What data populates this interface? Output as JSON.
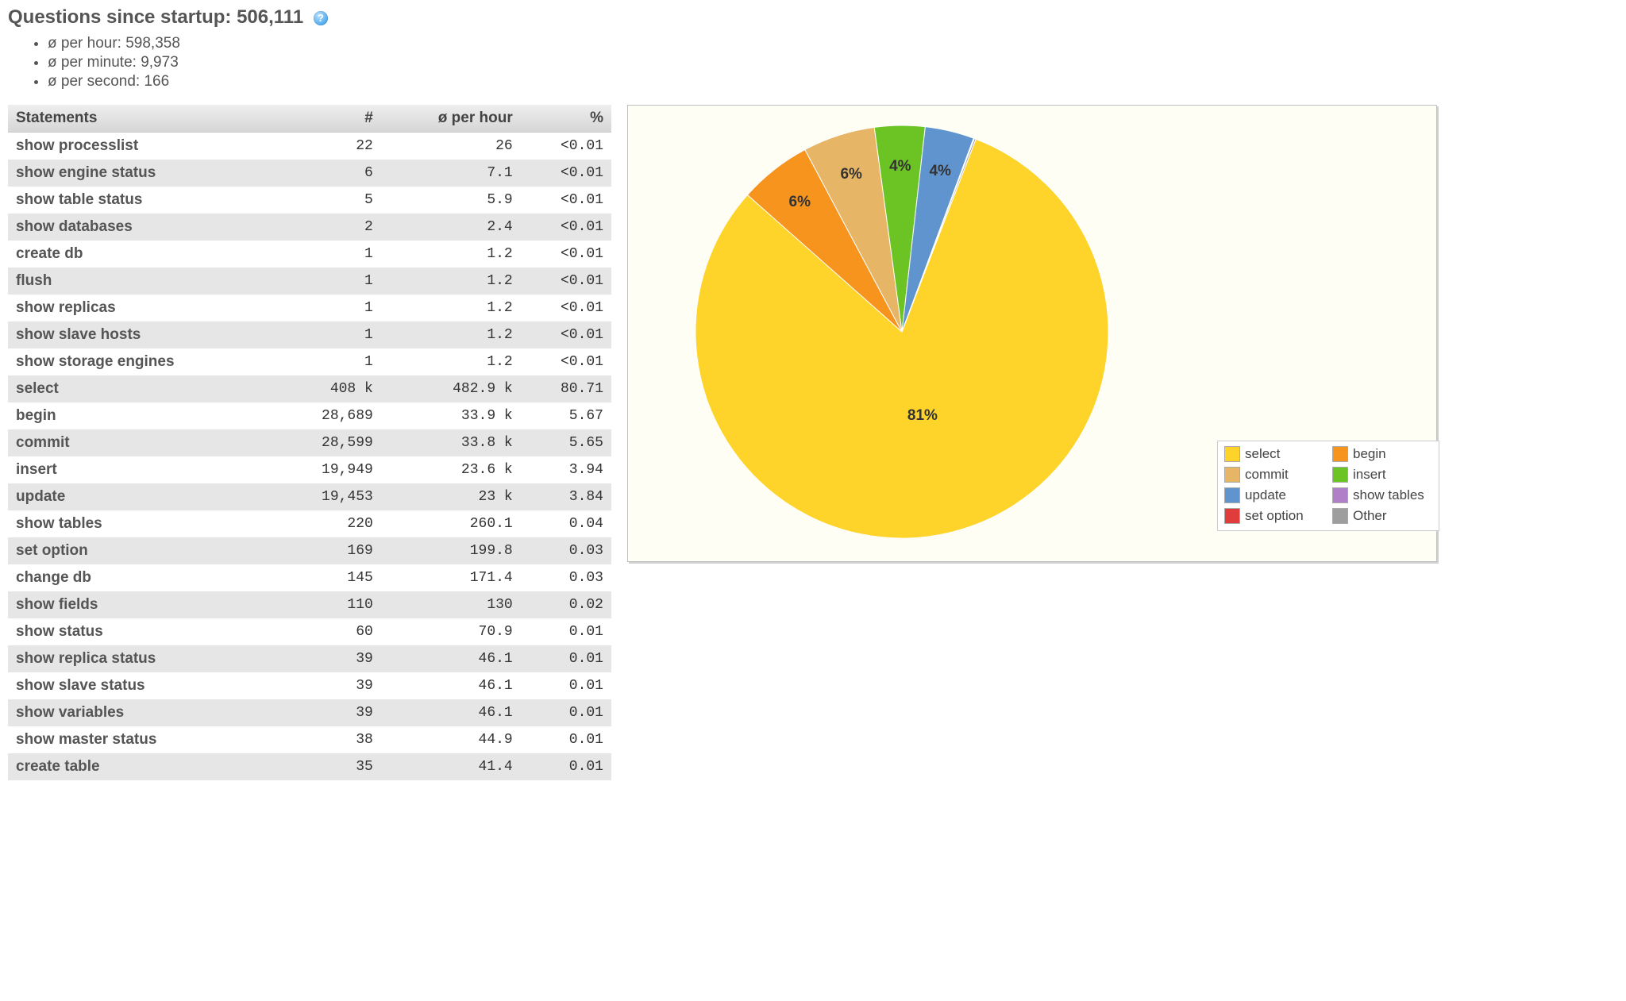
{
  "header": {
    "title_prefix": "Questions since startup: ",
    "title_value": "506,111",
    "help_tooltip": "?"
  },
  "summary": {
    "per_hour": "ø per hour: 598,358",
    "per_minute": "ø per minute: 9,973",
    "per_second": "ø per second: 166"
  },
  "table": {
    "headers": {
      "statements": "Statements",
      "count": "#",
      "per_hour": "ø per hour",
      "percent": "%"
    },
    "rows": [
      {
        "name": "show processlist",
        "count": "22",
        "per_hour": "26",
        "percent": "<0.01"
      },
      {
        "name": "show engine status",
        "count": "6",
        "per_hour": "7.1",
        "percent": "<0.01"
      },
      {
        "name": "show table status",
        "count": "5",
        "per_hour": "5.9",
        "percent": "<0.01"
      },
      {
        "name": "show databases",
        "count": "2",
        "per_hour": "2.4",
        "percent": "<0.01"
      },
      {
        "name": "create db",
        "count": "1",
        "per_hour": "1.2",
        "percent": "<0.01"
      },
      {
        "name": "flush",
        "count": "1",
        "per_hour": "1.2",
        "percent": "<0.01"
      },
      {
        "name": "show replicas",
        "count": "1",
        "per_hour": "1.2",
        "percent": "<0.01"
      },
      {
        "name": "show slave hosts",
        "count": "1",
        "per_hour": "1.2",
        "percent": "<0.01"
      },
      {
        "name": "show storage engines",
        "count": "1",
        "per_hour": "1.2",
        "percent": "<0.01"
      },
      {
        "name": "select",
        "count": "408 k",
        "per_hour": "482.9 k",
        "percent": "80.71"
      },
      {
        "name": "begin",
        "count": "28,689",
        "per_hour": "33.9 k",
        "percent": "5.67"
      },
      {
        "name": "commit",
        "count": "28,599",
        "per_hour": "33.8 k",
        "percent": "5.65"
      },
      {
        "name": "insert",
        "count": "19,949",
        "per_hour": "23.6 k",
        "percent": "3.94"
      },
      {
        "name": "update",
        "count": "19,453",
        "per_hour": "23 k",
        "percent": "3.84"
      },
      {
        "name": "show tables",
        "count": "220",
        "per_hour": "260.1",
        "percent": "0.04"
      },
      {
        "name": "set option",
        "count": "169",
        "per_hour": "199.8",
        "percent": "0.03"
      },
      {
        "name": "change db",
        "count": "145",
        "per_hour": "171.4",
        "percent": "0.03"
      },
      {
        "name": "show fields",
        "count": "110",
        "per_hour": "130",
        "percent": "0.02"
      },
      {
        "name": "show status",
        "count": "60",
        "per_hour": "70.9",
        "percent": "0.01"
      },
      {
        "name": "show replica status",
        "count": "39",
        "per_hour": "46.1",
        "percent": "0.01"
      },
      {
        "name": "show slave status",
        "count": "39",
        "per_hour": "46.1",
        "percent": "0.01"
      },
      {
        "name": "show variables",
        "count": "39",
        "per_hour": "46.1",
        "percent": "0.01"
      },
      {
        "name": "show master status",
        "count": "38",
        "per_hour": "44.9",
        "percent": "0.01"
      },
      {
        "name": "create table",
        "count": "35",
        "per_hour": "41.4",
        "percent": "0.01"
      }
    ]
  },
  "chart_data": {
    "type": "pie",
    "title": "",
    "series": [
      {
        "name": "select",
        "value": 80.71,
        "pct": 81,
        "label": "81%",
        "color": "#fed42a"
      },
      {
        "name": "begin",
        "value": 5.67,
        "pct": 6,
        "label": "6%",
        "color": "#f7941d"
      },
      {
        "name": "commit",
        "value": 5.65,
        "pct": 6,
        "label": "6%",
        "color": "#e6b565"
      },
      {
        "name": "insert",
        "value": 3.94,
        "pct": 4,
        "label": "4%",
        "color": "#6bc423"
      },
      {
        "name": "update",
        "value": 3.84,
        "pct": 4,
        "label": "4%",
        "color": "#5f94cf"
      },
      {
        "name": "show tables",
        "value": 0.04,
        "pct": 0,
        "label": "",
        "color": "#b07fc7"
      },
      {
        "name": "set option",
        "value": 0.03,
        "pct": 0,
        "label": "",
        "color": "#e03c3c"
      },
      {
        "name": "Other",
        "value": 0.12,
        "pct": 0,
        "label": "",
        "color": "#9e9e9e"
      }
    ],
    "legend_position": "bottom-right"
  }
}
